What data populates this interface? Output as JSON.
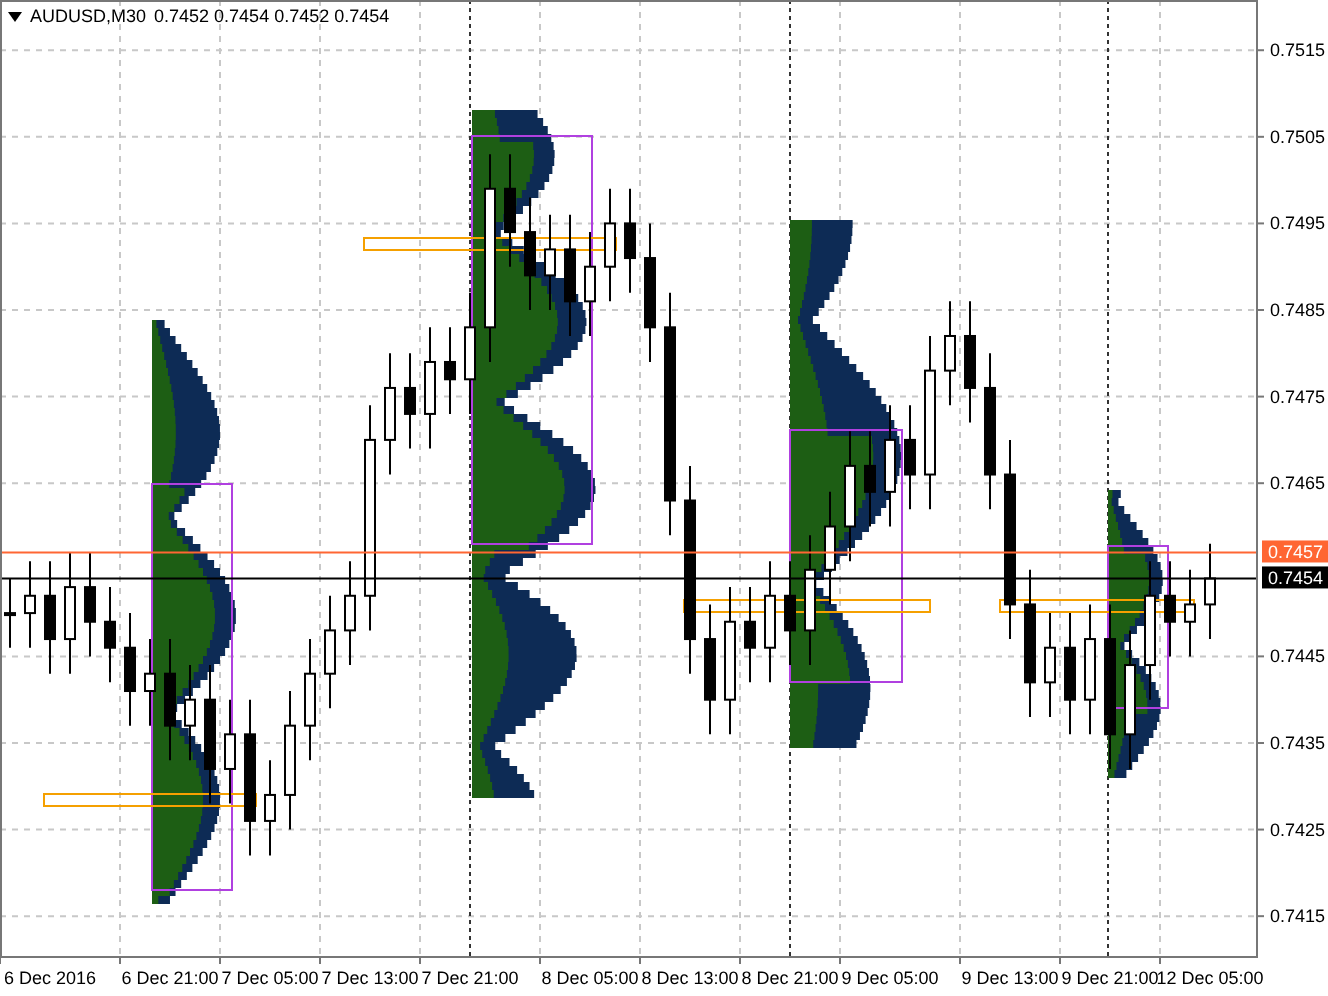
{
  "symbol": "AUDUSD,M30",
  "quote": "0.7452 0.7454 0.7452 0.7454",
  "chart_data": {
    "type": "candlestick",
    "grid": true,
    "ylim": [
      0.74104,
      0.75208
    ],
    "yticks": [
      {
        "value": 0.7415,
        "label": "0.7415"
      },
      {
        "value": 0.7425,
        "label": "0.7425"
      },
      {
        "value": 0.7435,
        "label": "0.7435"
      },
      {
        "value": 0.7445,
        "label": "0.7445"
      },
      {
        "value": 0.7465,
        "label": "0.7465"
      },
      {
        "value": 0.7475,
        "label": "0.7475"
      },
      {
        "value": 0.7485,
        "label": "0.7485"
      },
      {
        "value": 0.7495,
        "label": "0.7495"
      },
      {
        "value": 0.7505,
        "label": "0.7505"
      },
      {
        "value": 0.7515,
        "label": "0.7515"
      }
    ],
    "categories": [
      null,
      null,
      "6 Dec 2016",
      null,
      null,
      null,
      null,
      null,
      "6 Dec 21:00",
      null,
      null,
      null,
      null,
      "7 Dec 05:00",
      null,
      null,
      null,
      null,
      "7 Dec 13:00",
      null,
      null,
      null,
      null,
      "7 Dec 21:00",
      null,
      null,
      null,
      null,
      null,
      "8 Dec 05:00",
      null,
      null,
      null,
      null,
      "8 Dec 13:00",
      null,
      null,
      null,
      null,
      "8 Dec 21:00",
      null,
      null,
      null,
      null,
      "9 Dec 05:00",
      null,
      null,
      null,
      null,
      null,
      "9 Dec 13:00",
      null,
      null,
      null,
      null,
      "9 Dec 21:00",
      null,
      null,
      null,
      null,
      "12 Dec 05:00"
    ],
    "ohlc": [
      [
        0.745,
        0.7454,
        0.7446,
        0.745
      ],
      [
        0.745,
        0.7456,
        0.7446,
        0.7452
      ],
      [
        0.7452,
        0.7456,
        0.7443,
        0.7447
      ],
      [
        0.7447,
        0.7457,
        0.7443,
        0.7453
      ],
      [
        0.7453,
        0.7457,
        0.7445,
        0.7449
      ],
      [
        0.7449,
        0.7453,
        0.7442,
        0.7446
      ],
      [
        0.7446,
        0.745,
        0.7437,
        0.7441
      ],
      [
        0.7441,
        0.7447,
        0.7437,
        0.7443
      ],
      [
        0.7443,
        0.7447,
        0.7433,
        0.7437
      ],
      [
        0.7437,
        0.7444,
        0.7433,
        0.744
      ],
      [
        0.744,
        0.7444,
        0.7428,
        0.7432
      ],
      [
        0.7432,
        0.744,
        0.7428,
        0.7436
      ],
      [
        0.7436,
        0.744,
        0.7422,
        0.7426
      ],
      [
        0.7426,
        0.7433,
        0.7422,
        0.7429
      ],
      [
        0.7429,
        0.7441,
        0.7425,
        0.7437
      ],
      [
        0.7437,
        0.7447,
        0.7433,
        0.7443
      ],
      [
        0.7443,
        0.7452,
        0.7439,
        0.7448
      ],
      [
        0.7448,
        0.7456,
        0.7444,
        0.7452
      ],
      [
        0.7452,
        0.7474,
        0.7448,
        0.747
      ],
      [
        0.747,
        0.748,
        0.7466,
        0.7476
      ],
      [
        0.7476,
        0.748,
        0.7469,
        0.7473
      ],
      [
        0.7473,
        0.7483,
        0.7469,
        0.7479
      ],
      [
        0.7479,
        0.7483,
        0.7473,
        0.7477
      ],
      [
        0.7477,
        0.7487,
        0.7473,
        0.7483
      ],
      [
        0.7483,
        0.7503,
        0.7479,
        0.7499
      ],
      [
        0.7499,
        0.7503,
        0.749,
        0.7494
      ],
      [
        0.7494,
        0.7498,
        0.7485,
        0.7489
      ],
      [
        0.7489,
        0.7496,
        0.7485,
        0.7492
      ],
      [
        0.7492,
        0.7496,
        0.7482,
        0.7486
      ],
      [
        0.7486,
        0.7494,
        0.7482,
        0.749
      ],
      [
        0.749,
        0.7499,
        0.7486,
        0.7495
      ],
      [
        0.7495,
        0.7499,
        0.7487,
        0.7491
      ],
      [
        0.7491,
        0.7495,
        0.7479,
        0.7483
      ],
      [
        0.7483,
        0.7487,
        0.7459,
        0.7463
      ],
      [
        0.7463,
        0.7467,
        0.7443,
        0.7447
      ],
      [
        0.7447,
        0.7451,
        0.7436,
        0.744
      ],
      [
        0.744,
        0.7453,
        0.7436,
        0.7449
      ],
      [
        0.7449,
        0.7453,
        0.7442,
        0.7446
      ],
      [
        0.7446,
        0.7456,
        0.7442,
        0.7452
      ],
      [
        0.7452,
        0.7456,
        0.7444,
        0.7448
      ],
      [
        0.7448,
        0.7459,
        0.7444,
        0.7455
      ],
      [
        0.7455,
        0.7464,
        0.7451,
        0.746
      ],
      [
        0.746,
        0.7471,
        0.7456,
        0.7467
      ],
      [
        0.7467,
        0.7471,
        0.746,
        0.7464
      ],
      [
        0.7464,
        0.7474,
        0.746,
        0.747
      ],
      [
        0.747,
        0.7474,
        0.7462,
        0.7466
      ],
      [
        0.7466,
        0.7482,
        0.7462,
        0.7478
      ],
      [
        0.7478,
        0.7486,
        0.7474,
        0.7482
      ],
      [
        0.7482,
        0.7486,
        0.7472,
        0.7476
      ],
      [
        0.7476,
        0.748,
        0.7462,
        0.7466
      ],
      [
        0.7466,
        0.747,
        0.7447,
        0.7451
      ],
      [
        0.7451,
        0.7455,
        0.7438,
        0.7442
      ],
      [
        0.7442,
        0.745,
        0.7438,
        0.7446
      ],
      [
        0.7446,
        0.745,
        0.7436,
        0.744
      ],
      [
        0.744,
        0.7451,
        0.7436,
        0.7447
      ],
      [
        0.7447,
        0.7451,
        0.7432,
        0.7436
      ],
      [
        0.7436,
        0.7448,
        0.7432,
        0.7444
      ],
      [
        0.7444,
        0.7456,
        0.744,
        0.7452
      ],
      [
        0.7452,
        0.7456,
        0.7445,
        0.7449
      ],
      [
        0.7449,
        0.7455,
        0.7445,
        0.7451
      ],
      [
        0.7451,
        0.7458,
        0.7447,
        0.7454
      ]
    ],
    "ref_lines": [
      {
        "axis": "y",
        "value": 0.7457,
        "label": "0.7457",
        "color": "#ff6633"
      },
      {
        "axis": "y",
        "value": 0.7454,
        "label": "0.7454",
        "color": "#000000"
      }
    ]
  }
}
